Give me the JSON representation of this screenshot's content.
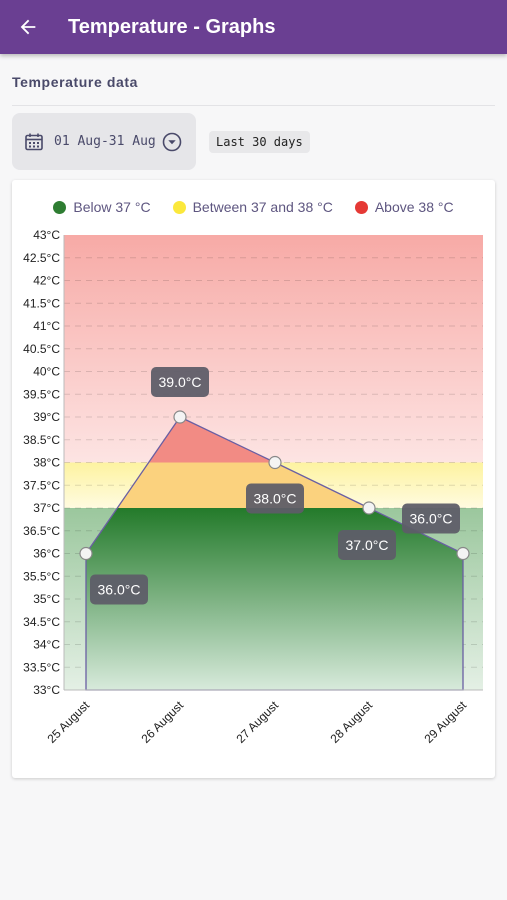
{
  "appbar": {
    "title": "Temperature - Graphs",
    "back_icon": "arrow-back-icon"
  },
  "section": {
    "label": "Temperature data"
  },
  "date_picker": {
    "value": "01 Aug-31 Aug",
    "icon": "calendar-icon",
    "chevron_icon": "chevron-down-circle-icon"
  },
  "range_chip": {
    "label": "Last 30 days"
  },
  "legend": [
    {
      "label": "Below 37 °C",
      "color": "#2e7d32"
    },
    {
      "label": "Between 37 and 38 °C",
      "color": "#fbe83c"
    },
    {
      "label": "Above 38 °C",
      "color": "#e53935"
    }
  ],
  "chart_data": {
    "type": "area",
    "categories": [
      "25 August",
      "26 August",
      "27 August",
      "28 August",
      "29 August"
    ],
    "values": [
      36.0,
      39.0,
      38.0,
      37.0,
      36.0
    ],
    "data_labels": [
      "36.0°C",
      "39.0°C",
      "38.0°C",
      "37.0°C",
      "36.0°C"
    ],
    "y_ticks": [
      "33°C",
      "33.5°C",
      "34°C",
      "34.5°C",
      "35°C",
      "35.5°C",
      "36°C",
      "36.5°C",
      "37°C",
      "37.5°C",
      "38°C",
      "38.5°C",
      "39°C",
      "39.5°C",
      "40°C",
      "40.5°C",
      "41°C",
      "41.5°C",
      "42°C",
      "42.5°C",
      "43°C"
    ],
    "ylim": [
      33,
      43
    ],
    "bands": [
      {
        "name": "Below 37 °C",
        "from": 33,
        "to": 37,
        "color": "#2e7d32"
      },
      {
        "name": "Between 37 and 38 °C",
        "from": 37,
        "to": 38,
        "color": "#fbe83c"
      },
      {
        "name": "Above 38 °C",
        "from": 38,
        "to": 43,
        "color": "#e53935"
      }
    ],
    "grid": true,
    "legend_position": "top"
  }
}
